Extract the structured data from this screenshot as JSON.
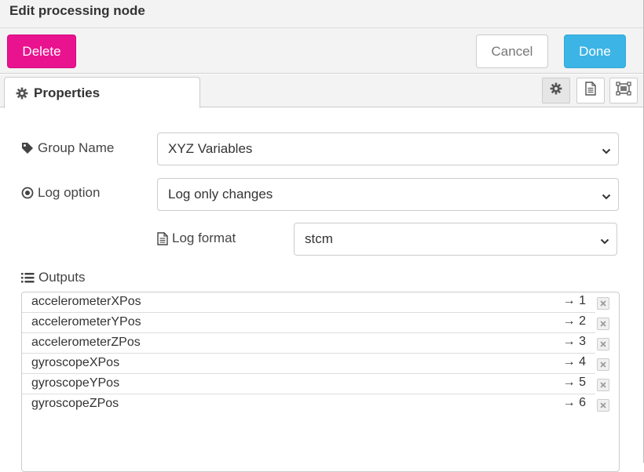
{
  "title": "Edit processing node",
  "buttons": {
    "delete": "Delete",
    "cancel": "Cancel",
    "done": "Done"
  },
  "tabs": [
    {
      "label": "Properties",
      "icon": "gear-icon"
    }
  ],
  "toolbar_icons": [
    "gear-icon",
    "description-icon",
    "appearance-icon"
  ],
  "form": {
    "group_name": {
      "label": "Group Name",
      "value": "XYZ Variables",
      "icon": "tag-icon"
    },
    "log_option": {
      "label": "Log option",
      "value": "Log only changes",
      "icon": "radio-dot-icon"
    },
    "log_format": {
      "label": "Log format",
      "value": "stcm",
      "icon": "file-icon"
    },
    "outputs_label": "Outputs",
    "outputs_icon": "list-icon"
  },
  "outputs": [
    {
      "name": "accelerometerXPos",
      "port": "→ 1"
    },
    {
      "name": "accelerometerYPos",
      "port": "→ 2"
    },
    {
      "name": "accelerometerZPos",
      "port": "→ 3"
    },
    {
      "name": "gyroscopeXPos",
      "port": "→ 4"
    },
    {
      "name": "gyroscopeYPos",
      "port": "→ 5"
    },
    {
      "name": "gyroscopeZPos",
      "port": "→ 6"
    }
  ],
  "colors": {
    "delete": "#e9138f",
    "done": "#3cb4e5"
  }
}
